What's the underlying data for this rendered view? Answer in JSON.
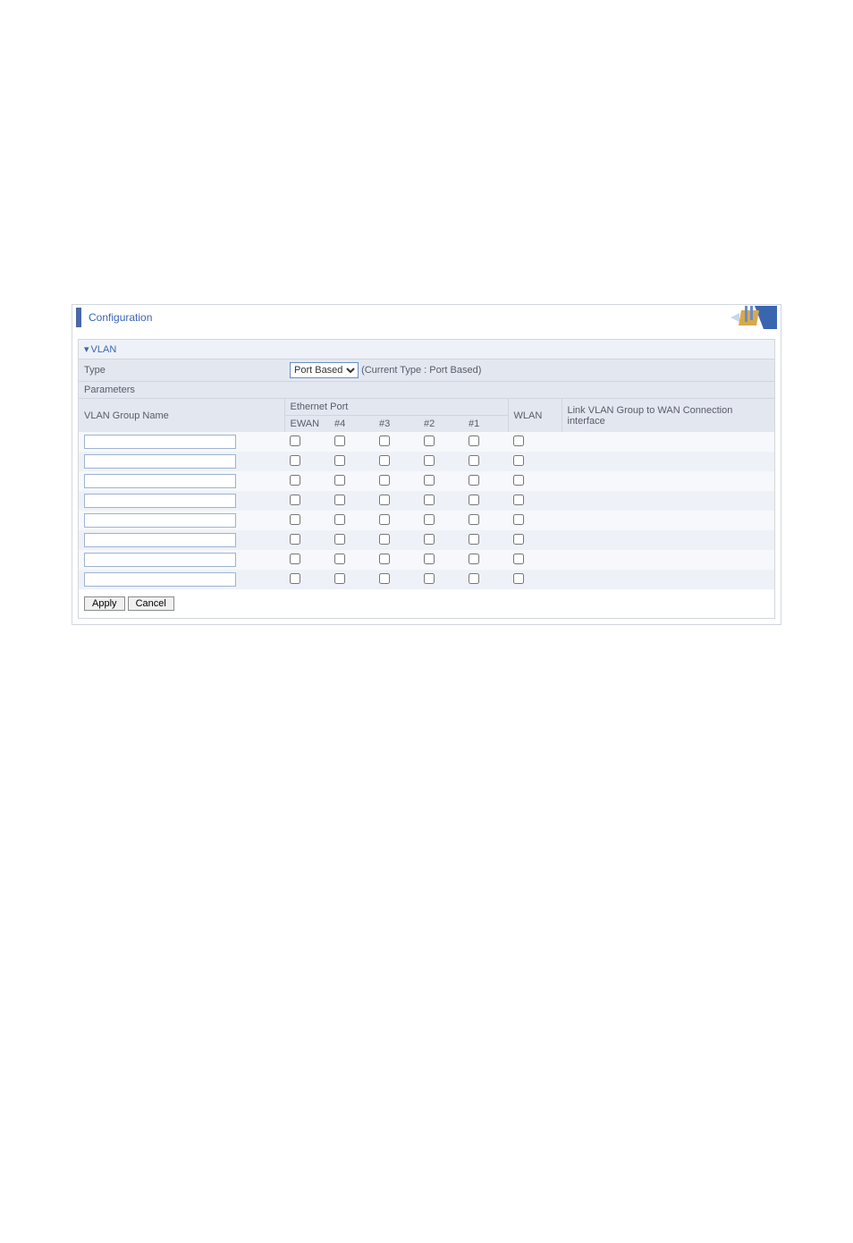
{
  "header": {
    "title": "Configuration"
  },
  "section": {
    "title": "VLAN"
  },
  "type_row": {
    "label": "Type",
    "select_value": "Port Based",
    "options": [
      "Port Based"
    ],
    "current_text": "(Current Type : Port Based)"
  },
  "parameters_row": {
    "label": "Parameters"
  },
  "columns": {
    "group_name": "VLAN Group Name",
    "ethernet_port": "Ethernet Port",
    "ports": [
      "EWAN",
      "#4",
      "#3",
      "#2",
      "#1"
    ],
    "wlan": "WLAN",
    "link": "Link VLAN Group to WAN Connection interface"
  },
  "rows": [
    {
      "name": "",
      "ports": [
        false,
        false,
        false,
        false,
        false
      ],
      "wlan": false,
      "link": ""
    },
    {
      "name": "",
      "ports": [
        false,
        false,
        false,
        false,
        false
      ],
      "wlan": false,
      "link": ""
    },
    {
      "name": "",
      "ports": [
        false,
        false,
        false,
        false,
        false
      ],
      "wlan": false,
      "link": ""
    },
    {
      "name": "",
      "ports": [
        false,
        false,
        false,
        false,
        false
      ],
      "wlan": false,
      "link": ""
    },
    {
      "name": "",
      "ports": [
        false,
        false,
        false,
        false,
        false
      ],
      "wlan": false,
      "link": ""
    },
    {
      "name": "",
      "ports": [
        false,
        false,
        false,
        false,
        false
      ],
      "wlan": false,
      "link": ""
    },
    {
      "name": "",
      "ports": [
        false,
        false,
        false,
        false,
        false
      ],
      "wlan": false,
      "link": ""
    },
    {
      "name": "",
      "ports": [
        false,
        false,
        false,
        false,
        false
      ],
      "wlan": false,
      "link": ""
    }
  ],
  "buttons": {
    "apply": "Apply",
    "cancel": "Cancel"
  }
}
